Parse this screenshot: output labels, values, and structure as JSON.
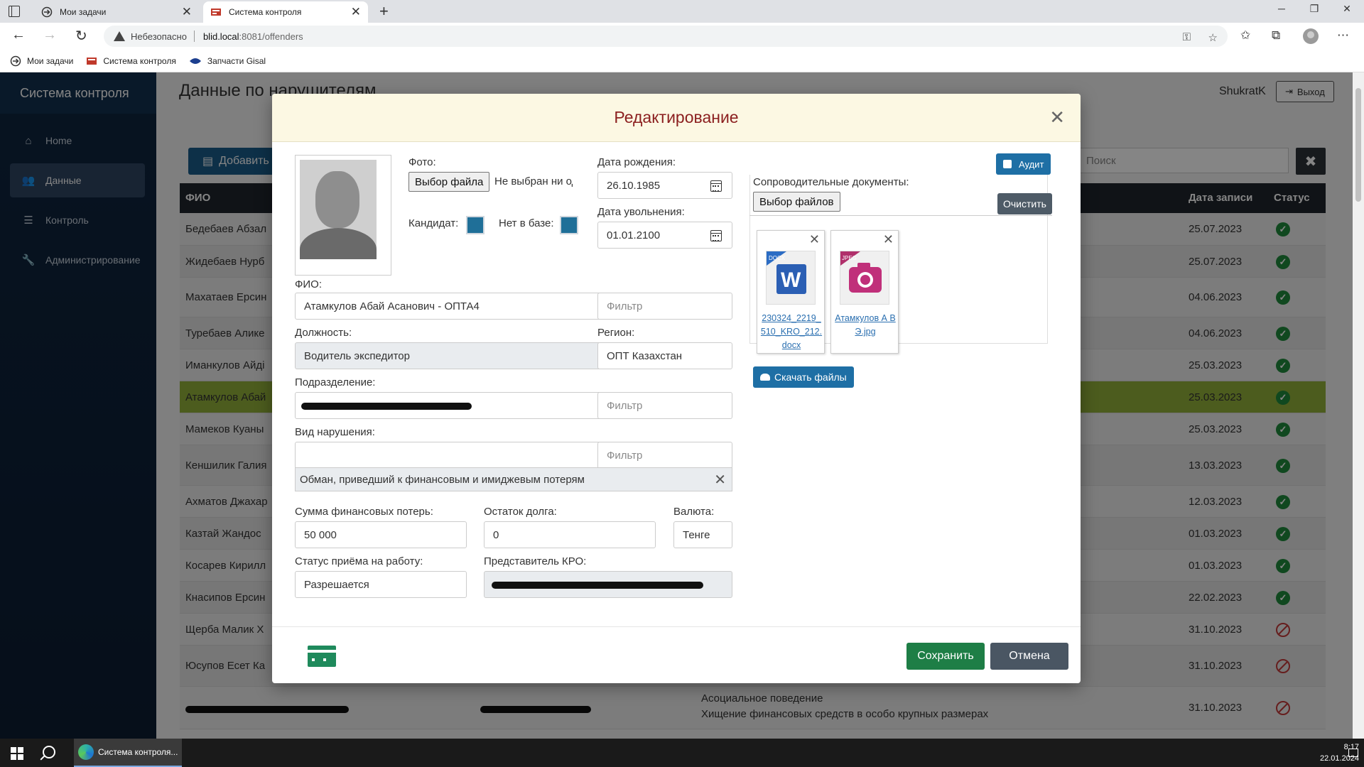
{
  "browser": {
    "tabs": [
      {
        "title": "Мои задачи"
      },
      {
        "title": "Система контроля"
      }
    ],
    "insecure_label": "Небезопасно",
    "url_host": "blid.local",
    "url_path": ":8081/offenders",
    "bookmarks": [
      {
        "label": "Мои задачи"
      },
      {
        "label": "Система контроля"
      },
      {
        "label": "Запчасти Gisal"
      }
    ]
  },
  "app": {
    "brand": "Система контроля",
    "nav": [
      {
        "label": "Home",
        "icon": "home-icon"
      },
      {
        "label": "Данные",
        "icon": "users-icon"
      },
      {
        "label": "Контроль",
        "icon": "list-icon"
      },
      {
        "label": "Администрирование",
        "icon": "wrench-icon"
      }
    ],
    "page_title": "Данные по нарушителям",
    "user": "ShukratK",
    "logout": "Выход",
    "add_button": "Добавить",
    "search_placeholder": "Поиск",
    "table": {
      "headers": {
        "fio": "ФИО",
        "date": "Дата записи",
        "status": "Статус"
      },
      "rows": [
        {
          "fio": "Бедебаев Абзал",
          "date": "25.07.2023",
          "status": "ok"
        },
        {
          "fio": "Жидебаев Нурб",
          "date": "25.07.2023",
          "status": "ok"
        },
        {
          "fio": "Махатаев Ерсин",
          "date": "04.06.2023",
          "status": "ok"
        },
        {
          "fio": "Туребаев Алике",
          "date": "04.06.2023",
          "status": "ok"
        },
        {
          "fio": "Иманкулов Айді",
          "date": "25.03.2023",
          "status": "ok"
        },
        {
          "fio": "Атамкулов Абай",
          "date": "25.03.2023",
          "status": "ok"
        },
        {
          "fio": "Мамеков Куаны",
          "date": "25.03.2023",
          "status": "ok"
        },
        {
          "fio": "Кеншилик Галия",
          "date": "13.03.2023",
          "status": "ok"
        },
        {
          "fio": "Ахматов Джахар",
          "date": "12.03.2023",
          "status": "ok"
        },
        {
          "fio": "Казтай Жандос",
          "date": "01.03.2023",
          "status": "ok"
        },
        {
          "fio": "Косарев Кирилл",
          "date": "01.03.2023",
          "status": "ok"
        },
        {
          "fio": "Кнасипов Ерсин",
          "date": "22.02.2023",
          "status": "ok"
        },
        {
          "fio": "Щерба Малик Х",
          "date": "31.10.2023",
          "status": "blocked"
        },
        {
          "fio": "Юсупов Есет Ка",
          "date": "31.10.2023",
          "status": "blocked",
          "extra": "Хищение финансовых средств в особо крупных размерах"
        },
        {
          "fio": "",
          "date": "31.10.2023",
          "status": "blocked",
          "extra": "Асоциальное поведение",
          "extra2": "Хищение финансовых средств в особо крупных размерах"
        }
      ]
    }
  },
  "modal": {
    "title": "Редактирование",
    "photo_label": "Фото:",
    "choose_file": "Выбор файла",
    "no_file": "Не выбран ни один",
    "candidate_label": "Кандидат:",
    "not_in_base_label": "Нет в базе:",
    "birth_label": "Дата рождения:",
    "birth_value": "26.10.1985",
    "dismissal_label": "Дата увольнения:",
    "dismissal_value": "01.01.2100",
    "fio_label": "ФИО:",
    "fio_value": "Атамкулов Абай Асанович - ОПТА4",
    "filter_placeholder": "Фильтр",
    "position_label": "Должность:",
    "position_value": "Водитель экспедитор",
    "region_label": "Регион:",
    "region_value": "ОПТ Казахстан",
    "division_label": "Подразделение:",
    "violation_label": "Вид нарушения:",
    "violation_tag": "Обман, приведший к финансовым и имиджевым потерям",
    "loss_label": "Сумма финансовых потерь:",
    "loss_value": "50 000",
    "debt_label": "Остаток долга:",
    "debt_value": "0",
    "currency_label": "Валюта:",
    "currency_value": "Тенге",
    "hiring_label": "Статус приёма на работу:",
    "hiring_value": "Разрешается",
    "kro_label": "Представитель КРО:",
    "audit": "Аудит",
    "docs_label": "Сопроводительные документы:",
    "choose_files": "Выбор файлов",
    "clear": "Очистить",
    "files": [
      {
        "name": "230324_2219_510_KRO_212.docx",
        "type": "DOCX"
      },
      {
        "name": "Атамкулов А ВЭ.jpg",
        "type": "JPEG"
      }
    ],
    "download": "Скачать файлы",
    "save": "Сохранить",
    "cancel": "Отмена"
  },
  "taskbar": {
    "app_label": "Система контроля...",
    "time": "8:17",
    "date": "22.01.2024"
  },
  "colors": {
    "sidebar_bg": "#0f2640",
    "accent_blue": "#1e6fa5",
    "selected_row": "#93b03a",
    "save_green": "#1e7e46",
    "modal_title": "#8b1f1f"
  }
}
